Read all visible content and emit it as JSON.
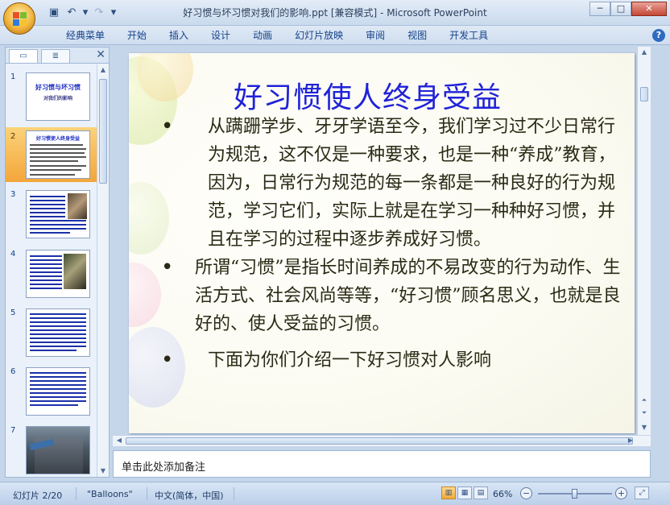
{
  "window": {
    "title": "好习惯与坏习惯对我们的影响.ppt [兼容模式] - Microsoft PowerPoint",
    "minimize_glyph": "─",
    "maximize_glyph": "□",
    "close_glyph": "✕"
  },
  "quick_access": [
    {
      "icon": "save-icon",
      "glyph": "▣"
    },
    {
      "icon": "undo-icon",
      "glyph": "↶"
    },
    {
      "icon": "undo-dropdown-icon",
      "glyph": "▾"
    },
    {
      "icon": "redo-icon",
      "glyph": "↷"
    },
    {
      "icon": "customize-qat-icon",
      "glyph": "▾"
    }
  ],
  "ribbon": {
    "tabs": [
      "经典菜单",
      "开始",
      "插入",
      "设计",
      "动画",
      "幻灯片放映",
      "审阅",
      "视图",
      "开发工具"
    ],
    "help_glyph": "?"
  },
  "slides_pane": {
    "tab_slides_glyph": "▭",
    "tab_outline_glyph": "≣",
    "close_glyph": "✕",
    "selected_index": 2,
    "thumbnails": [
      {
        "number": "1",
        "title": "好习惯与坏习惯",
        "subtitle": "对我们的影响"
      },
      {
        "number": "2",
        "title": "好习惯使人终身受益"
      },
      {
        "number": "3"
      },
      {
        "number": "4"
      },
      {
        "number": "5"
      },
      {
        "number": "6"
      },
      {
        "number": "7"
      }
    ]
  },
  "slide": {
    "title": "好习惯使人终身受益",
    "bullets": [
      {
        "text": "从蹒跚学步、牙牙学语至今，我们学习过不少日常行为规范，这不仅是一种要求，也是一种“养成”教育，因为，日常行为规范的每一条都是一种良好的行为规范，学习它们，实际上就是在学习一种种好习惯，并且在学习的过程中逐步养成好习惯。"
      },
      {
        "text": "所谓“习惯”是指长时间养成的不易改变的行为动作、生活方式、社会风尚等等，“好习惯”顾名思义，也就是良好的、使人受益的习惯。"
      },
      {
        "text": "下面为你们介绍一下好习惯对人影响"
      }
    ]
  },
  "notes": {
    "placeholder": "单击此处添加备注"
  },
  "status": {
    "slide_indicator": "幻灯片 2/20",
    "theme": "\"Balloons\"",
    "language": "中文(简体，中国)",
    "zoom": "66%",
    "zoom_fraction": 0.5,
    "zoom_out_glyph": "−",
    "zoom_in_glyph": "+",
    "fit_glyph": "⤢",
    "view_normal_glyph": "▥",
    "view_sorter_glyph": "▦",
    "view_show_glyph": "▤"
  }
}
